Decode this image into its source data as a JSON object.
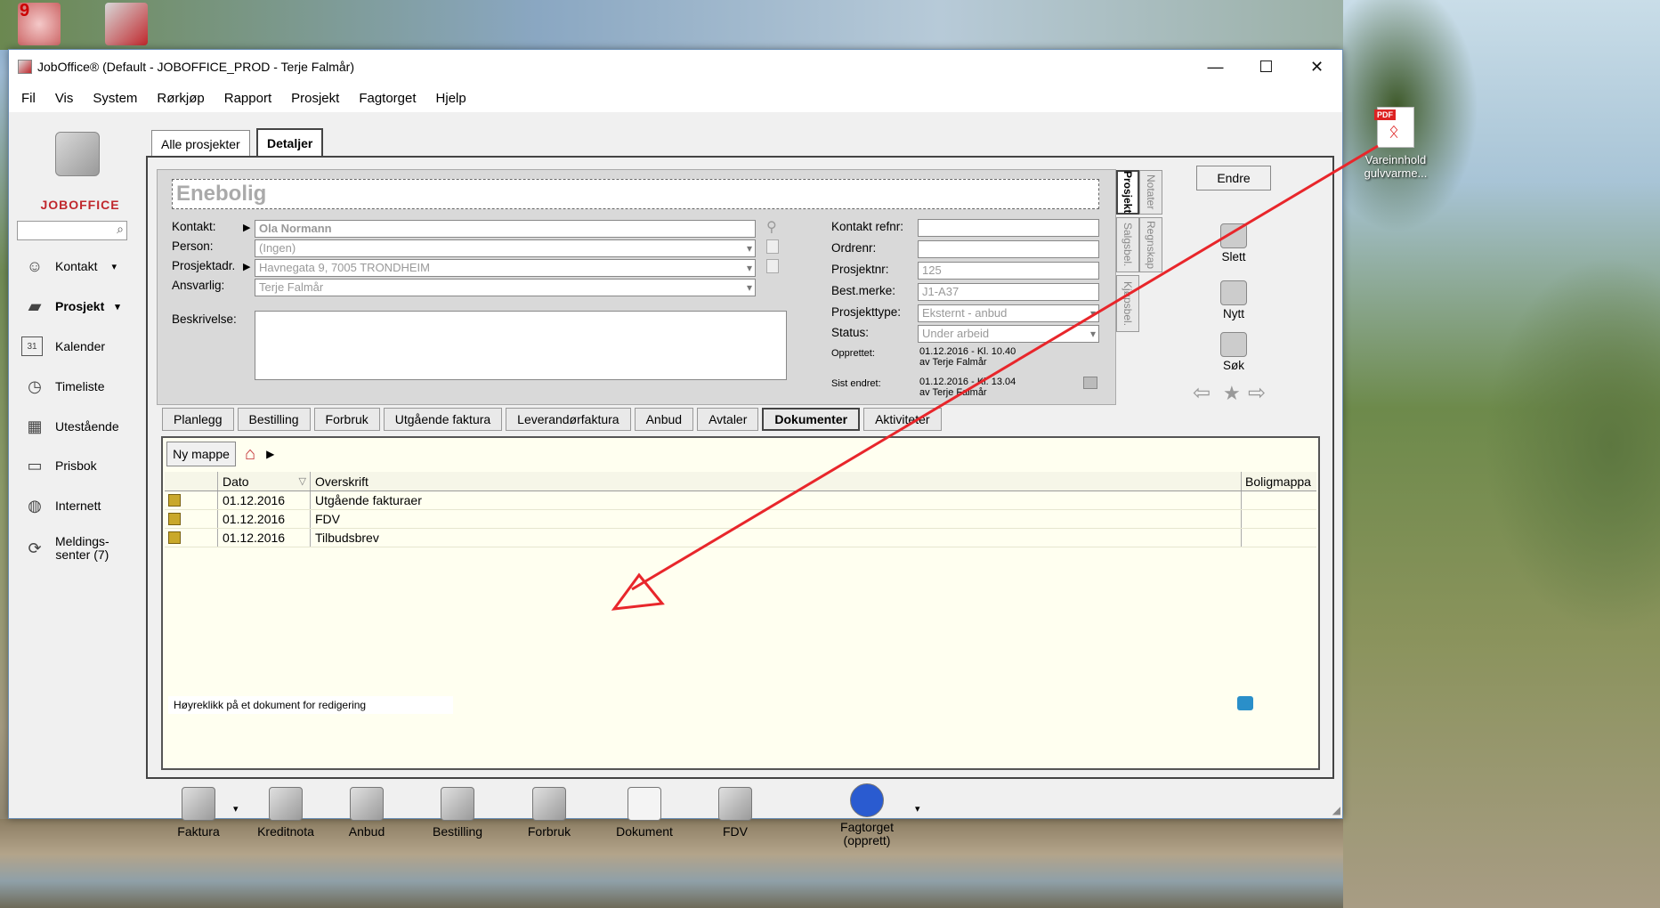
{
  "desktop": {
    "pdf_icon_badge": "PDF",
    "pdf_icon_label_1": "Vareinnhold",
    "pdf_icon_label_2": "gulvvarme...",
    "top_icon_badge": "9"
  },
  "window": {
    "title": "JobOffice®   (Default - JOBOFFICE_PROD - Terje Falmår)",
    "minimize": "—",
    "maximize": "☐",
    "close": "✕"
  },
  "menu": [
    "Fil",
    "Vis",
    "System",
    "Rørkjøp",
    "Rapport",
    "Prosjekt",
    "Fagtorget",
    "Hjelp"
  ],
  "sidebar": {
    "logo_text": "JOBOFFICE",
    "items": [
      {
        "label": "Kontakt",
        "icon": "contact-icon",
        "dropdown": "▾"
      },
      {
        "label": "Prosjekt",
        "icon": "project-icon",
        "dropdown": "▾"
      },
      {
        "label": "Kalender",
        "icon": "calendar-icon",
        "badge": "31"
      },
      {
        "label": "Timeliste",
        "icon": "clock-icon"
      },
      {
        "label": "Utestående",
        "icon": "outstanding-icon"
      },
      {
        "label": "Prisbok",
        "icon": "pricebook-icon"
      },
      {
        "label": "Internett",
        "icon": "globe-icon"
      },
      {
        "label": "Meldings-",
        "label2": "senter (7)",
        "icon": "message-center-icon"
      }
    ]
  },
  "tabs": {
    "all_projects": "Alle prosjekter",
    "details": "Detaljer"
  },
  "project": {
    "name": "Enebolig",
    "kontakt_label": "Kontakt:",
    "kontakt_value": "Ola Normann",
    "person_label": "Person:",
    "person_value": "(Ingen)",
    "adr_label": "Prosjektadr.",
    "adr_value": "Havnegata 9, 7005 TRONDHEIM",
    "ansvarlig_label": "Ansvarlig:",
    "ansvarlig_value": "Terje Falmår",
    "beskrivelse_label": "Beskrivelse:",
    "kontakt_refnr_label": "Kontakt refnr:",
    "ordrenr_label": "Ordrenr:",
    "prosjektnr_label": "Prosjektnr:",
    "prosjektnr_value": "125",
    "bestmerke_label": "Best.merke:",
    "bestmerke_value": "J1-A37",
    "prosjekttype_label": "Prosjekttype:",
    "prosjekttype_value": "Eksternt - anbud",
    "status_label": "Status:",
    "status_value": "Under arbeid",
    "opprettet_label": "Opprettet:",
    "opprettet_value_1": "01.12.2016 - Kl. 10.40",
    "opprettet_value_2": "av Terje Falmår",
    "sist_endret_label": "Sist endret:",
    "sist_endret_value_1": "01.12.2016 - Kl. 13.04",
    "sist_endret_value_2": "av Terje Falmår"
  },
  "vtabs": {
    "prosjekt": "Prosjekt",
    "notater": "Notater",
    "salgsbel": "Salgsbel.",
    "regnskap": "Regnskap",
    "kjopsbel": "Kjøpsbel."
  },
  "actions": {
    "endre": "Endre",
    "slett": "Slett",
    "nytt": "Nytt",
    "sok": "Søk",
    "prev": "⇦",
    "star": "★",
    "next": "⇨"
  },
  "subtabs": [
    "Planlegg",
    "Bestilling",
    "Forbruk",
    "Utgående faktura",
    "Leverandørfaktura",
    "Anbud",
    "Avtaler",
    "Dokumenter",
    "Aktiviteter"
  ],
  "documents": {
    "new_folder": "Ny mappe",
    "columns": {
      "dato": "Dato",
      "overskrift": "Overskrift",
      "boligmappa": "Boligmappa",
      "sort": "▽"
    },
    "rows": [
      {
        "dato": "01.12.2016",
        "overskrift": "Utgående fakturaer"
      },
      {
        "dato": "01.12.2016",
        "overskrift": "FDV"
      },
      {
        "dato": "01.12.2016",
        "overskrift": "Tilbudsbrev"
      }
    ],
    "hint": "Høyreklikk på et dokument for redigering"
  },
  "bottom": [
    {
      "label": "Faktura",
      "icon": "invoice-icon",
      "dropdown": "▾"
    },
    {
      "label": "Kreditnota",
      "icon": "credit-note-icon"
    },
    {
      "label": "Anbud",
      "icon": "tender-icon"
    },
    {
      "label": "Bestilling",
      "icon": "order-icon"
    },
    {
      "label": "Forbruk",
      "icon": "consumption-icon"
    },
    {
      "label": "Dokument",
      "icon": "document-icon"
    },
    {
      "label": "FDV",
      "icon": "fdv-icon"
    },
    {
      "label": "Fagtorget",
      "label2": "(opprett)",
      "icon": "fagtorget-icon",
      "dropdown": "▾"
    }
  ],
  "colors": {
    "arrow": "#e8262b",
    "logo": "#c0282d",
    "doc_bg": "#fffff0"
  }
}
